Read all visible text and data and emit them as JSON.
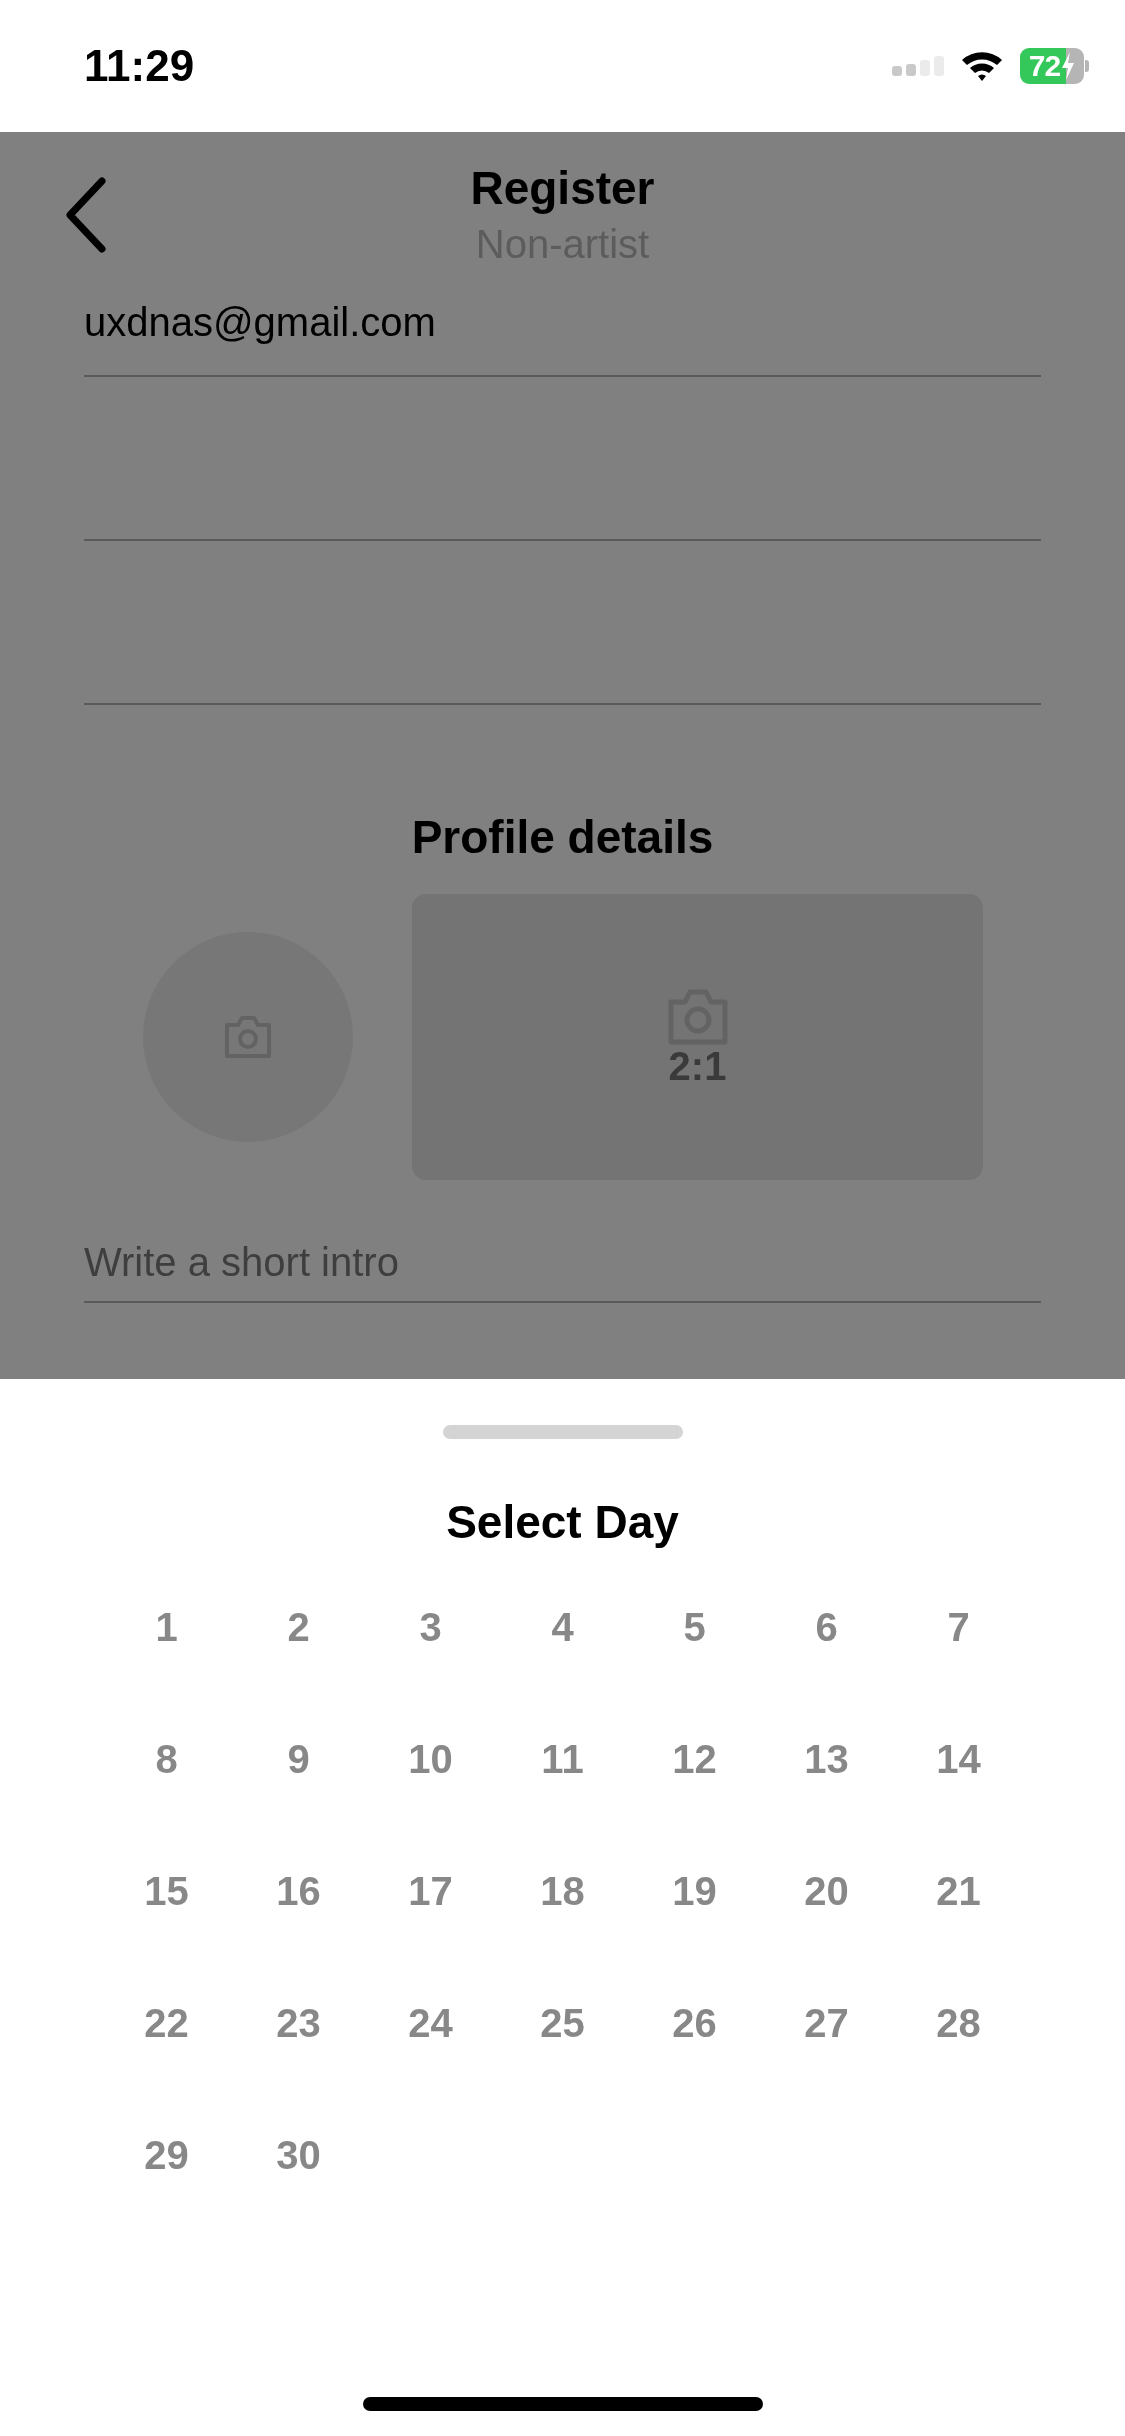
{
  "status_bar": {
    "time": "11:29",
    "battery": "72"
  },
  "header": {
    "title": "Register",
    "subtitle": "Non-artist"
  },
  "fields": [
    {
      "kind": "filled",
      "value": "uxdnas@gmail.com"
    },
    {
      "kind": "empty"
    },
    {
      "kind": "empty"
    }
  ],
  "profile": {
    "title": "Profile details",
    "banner_ratio": "2:1",
    "intro_placeholder": "Write a short intro"
  },
  "sheet": {
    "title": "Select Day",
    "days": [
      "1",
      "2",
      "3",
      "4",
      "5",
      "6",
      "7",
      "8",
      "9",
      "10",
      "11",
      "12",
      "13",
      "14",
      "15",
      "16",
      "17",
      "18",
      "19",
      "20",
      "21",
      "22",
      "23",
      "24",
      "25",
      "26",
      "27",
      "28",
      "29",
      "30"
    ]
  }
}
